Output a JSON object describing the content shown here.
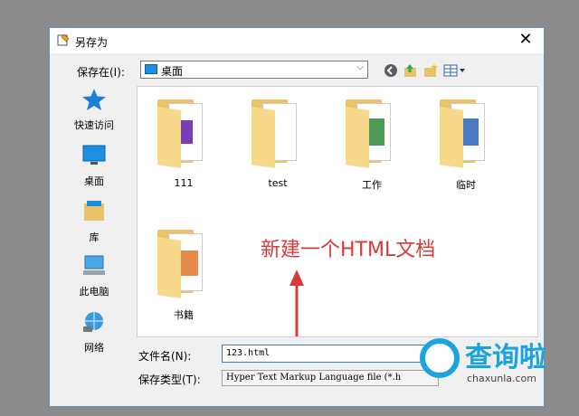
{
  "window": {
    "title": "另存为",
    "close_glyph": "✕"
  },
  "location": {
    "label": "保存在(I):",
    "value": "桌面",
    "caret": "⌵"
  },
  "toolbar": {
    "icons": [
      "back-icon",
      "up-folder-icon",
      "new-folder-icon",
      "view-menu-icon"
    ]
  },
  "sidebar": {
    "items": [
      {
        "label": "快速访问",
        "icon": "star-icon"
      },
      {
        "label": "桌面",
        "icon": "desktop-icon"
      },
      {
        "label": "库",
        "icon": "library-icon"
      },
      {
        "label": "此电脑",
        "icon": "computer-icon"
      },
      {
        "label": "网络",
        "icon": "network-icon"
      }
    ]
  },
  "files": [
    {
      "name": "111",
      "doc_color": "#7a3db8"
    },
    {
      "name": "test",
      "doc_color": "#ffffff"
    },
    {
      "name": "工作",
      "doc_color": "#2f8a3a"
    },
    {
      "name": "临时",
      "doc_color": "#2b62b8"
    },
    {
      "name": "书籍",
      "doc_color": "#e0762a"
    }
  ],
  "annotation": {
    "text": "新建一个HTML文档",
    "color": "#d83a3a"
  },
  "filename": {
    "label": "文件名(N):",
    "value": "123.html"
  },
  "filetype": {
    "label": "保存类型(T):",
    "value": "Hyper Text Markup Language file (*.h"
  },
  "watermark": {
    "text": "查询啦",
    "url": "chaxunla.com"
  }
}
